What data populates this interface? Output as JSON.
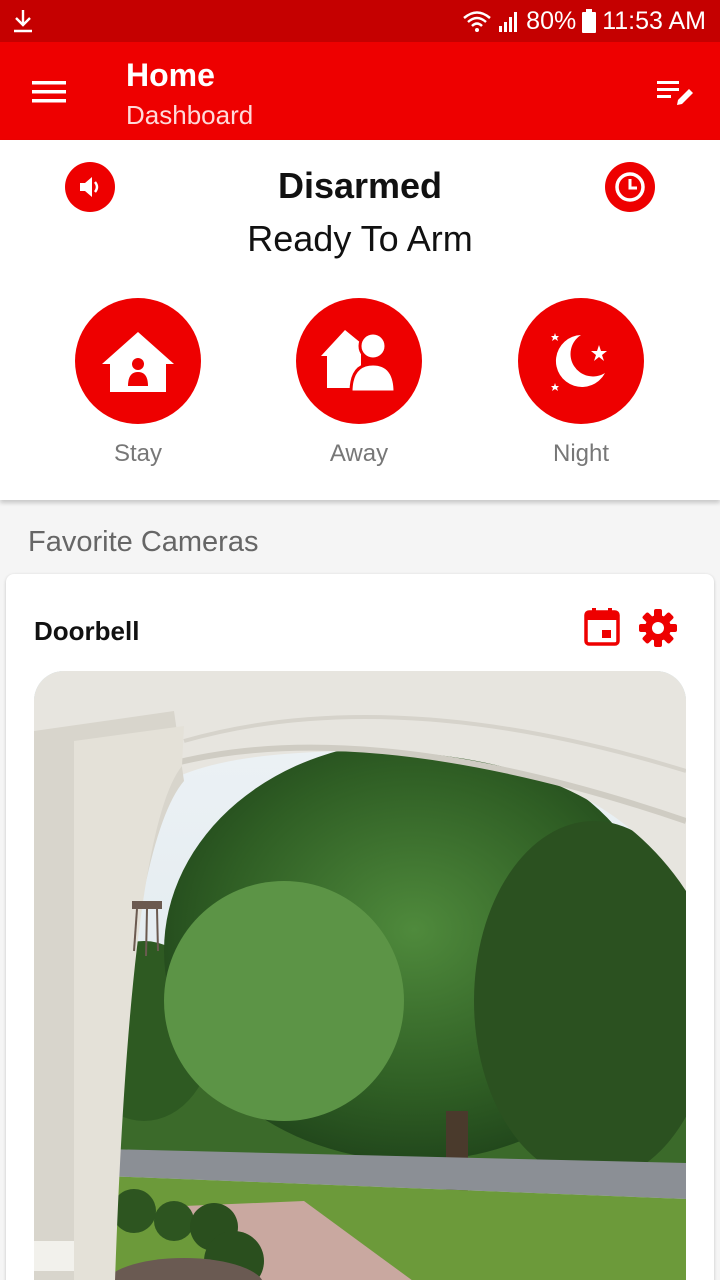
{
  "status_bar": {
    "battery": "80%",
    "time": "11:53 AM",
    "icons": [
      "download-icon",
      "wifi-icon",
      "signal-icon",
      "battery-icon"
    ]
  },
  "app_bar": {
    "title": "Home",
    "subtitle": "Dashboard",
    "icons": [
      "menu-icon",
      "edit-list-icon"
    ]
  },
  "security": {
    "status": "Disarmed",
    "substatus": "Ready To Arm",
    "icons": [
      "speaker-icon",
      "clock-icon"
    ],
    "modes": [
      {
        "label": "Stay",
        "icon": "house-person-icon"
      },
      {
        "label": "Away",
        "icon": "house-away-icon"
      },
      {
        "label": "Night",
        "icon": "moon-stars-icon"
      }
    ]
  },
  "favorites": {
    "heading": "Favorite Cameras",
    "cameras": [
      {
        "name": "Doorbell",
        "icons": [
          "calendar-icon",
          "gear-icon"
        ]
      }
    ]
  },
  "colors": {
    "brand_red": "#ee0000",
    "status_bar": "#c50000"
  }
}
